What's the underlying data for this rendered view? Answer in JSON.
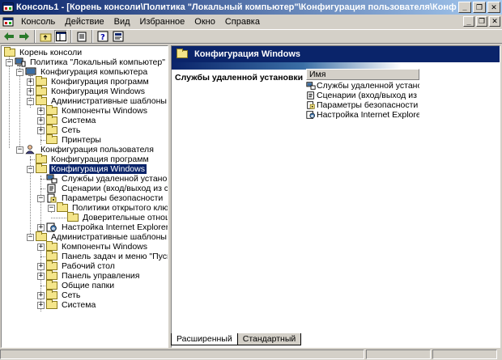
{
  "window": {
    "title": "Консоль1 - [Корень консоли\\Политика \"Локальный компьютер\"\\Конфигурация пользователя\\Конфигурация Windows]",
    "controls": [
      "minimize",
      "maximize",
      "close"
    ]
  },
  "menu": {
    "items": [
      "Консоль",
      "Действие",
      "Вид",
      "Избранное",
      "Окно",
      "Справка"
    ]
  },
  "toolbar": {
    "buttons": [
      "back-icon",
      "forward-icon",
      "up-folder-icon",
      "show-tree-icon",
      "export-list-icon",
      "help-icon",
      "properties-icon"
    ]
  },
  "tree": {
    "items": [
      {
        "label": "Корень консоли"
      },
      {
        "label": "Политика \"Локальный компьютер\""
      },
      {
        "label": "Конфигурация компьютера"
      },
      {
        "label": "Конфигурация программ"
      },
      {
        "label": "Конфигурация Windows"
      },
      {
        "label": "Административные шаблоны"
      },
      {
        "label": "Компоненты Windows"
      },
      {
        "label": "Система"
      },
      {
        "label": "Сеть"
      },
      {
        "label": "Принтеры"
      },
      {
        "label": "Конфигурация пользователя"
      },
      {
        "label": "Конфигурация программ"
      },
      {
        "label": "Конфигурация Windows"
      },
      {
        "label": "Службы удаленной установки"
      },
      {
        "label": "Сценарии (вход/выход из систе"
      },
      {
        "label": "Параметры безопасности"
      },
      {
        "label": "Политики открытого ключа"
      },
      {
        "label": "Доверительные отношен"
      },
      {
        "label": "Настройка Internet Explorer"
      },
      {
        "label": "Административные шаблоны"
      },
      {
        "label": "Компоненты Windows"
      },
      {
        "label": "Панель задач и меню \"Пуск\""
      },
      {
        "label": "Рабочий стол"
      },
      {
        "label": "Панель управления"
      },
      {
        "label": "Общие папки"
      },
      {
        "label": "Сеть"
      },
      {
        "label": "Система"
      }
    ]
  },
  "right": {
    "header": "Конфигурация Windows",
    "selected_title": "Службы удаленной установки",
    "column": "Имя",
    "items": [
      {
        "label": "Службы удаленной установки"
      },
      {
        "label": "Сценарии (вход/выход из с..."
      },
      {
        "label": "Параметры безопасности"
      },
      {
        "label": "Настройка Internet Explorer"
      }
    ]
  },
  "tabs": {
    "extended": "Расширенный",
    "standard": "Стандартный"
  }
}
